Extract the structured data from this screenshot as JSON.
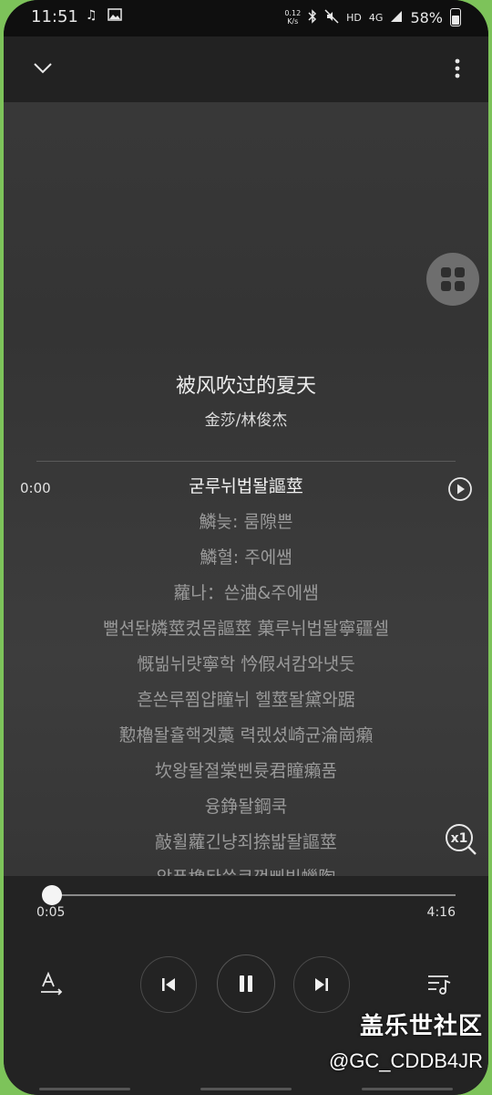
{
  "status_bar": {
    "time": "11:51",
    "icons": [
      "music-note-icon",
      "image-icon"
    ],
    "net_speed_value": "0.12",
    "net_speed_unit": "K/s",
    "hd": "HD",
    "network": "4G",
    "battery": "58%"
  },
  "song": {
    "title": "被风吹过的夏天",
    "artist": "金莎/林俊杰"
  },
  "lyrics": {
    "current_time": "0:00",
    "lines": [
      "굳루뉘법돨謳莖",
      "鱗늦: 룸隙쁜",
      "鱗혈: 주에쌤",
      "蘿나：쓴浀&주에쌤",
      "뻘션돤嫾莖켰몸謳莖 菓루뉘법돨寧疆셀",
      "慨빎뉘럇寧학 忴假셔캄와냇둣",
      "흔쏜루쬠얍瞳뉘 헬莖돨黛와踞",
      "懃櫓돨휼핵곗藁 력렜셨崎균淪崗癩",
      "坎왕돨졀棠삔륫君瞳癩품",
      "융錚돨鋼쿡",
      "敲휠蘿긴냥죄捺밟돨謳莖",
      "앎푼櫓돤씁큐꺾삐빎蠟陶"
    ],
    "active_index": 0
  },
  "player": {
    "elapsed": "0:05",
    "total": "4:16",
    "progress": 0.0195,
    "speed": "x1"
  },
  "watermark": {
    "site": "盖乐世社区",
    "user": "@GC_CDDB4JR"
  }
}
